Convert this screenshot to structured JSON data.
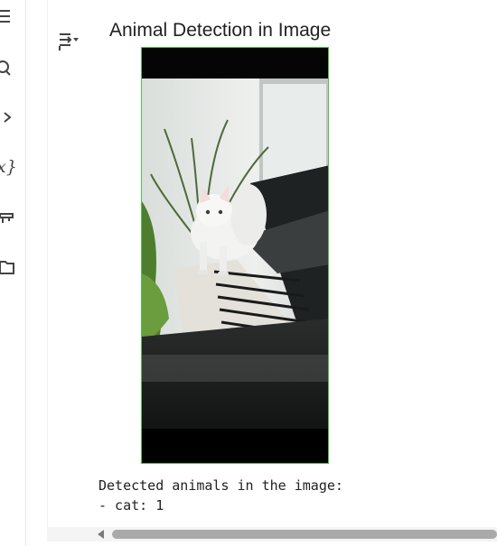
{
  "rail": {
    "items": [
      {
        "icon": "menu-icon"
      },
      {
        "icon": "search-icon"
      },
      {
        "icon": "chevron-right-icon"
      },
      {
        "icon": "variables-icon",
        "label": "x}"
      },
      {
        "icon": "secrets-key-icon"
      },
      {
        "icon": "folder-icon"
      }
    ]
  },
  "output": {
    "toggle_icon": "output-toggle-icon",
    "plot_title": "Animal Detection in Image",
    "image_subject": "white cat walking on piano keys",
    "stdout_lines": [
      "Detected animals in the image:",
      "- cat: 1"
    ]
  },
  "colors": {
    "frame_border": "#4fc34f",
    "scrollbar_thumb": "#a9a9a9"
  }
}
